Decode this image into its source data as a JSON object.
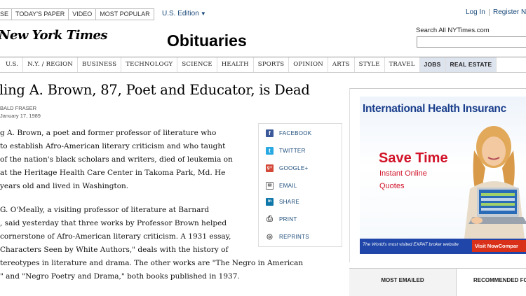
{
  "topbar": {
    "nav": [
      "SE",
      "TODAY'S PAPER",
      "VIDEO",
      "MOST POPULAR"
    ],
    "edition": "U.S. Edition",
    "login": "Log In",
    "register": "Register N"
  },
  "header": {
    "logo": "New York Times",
    "section": "Obituaries",
    "search_label": "Search All NYTimes.com"
  },
  "section_nav": [
    "U.S.",
    "N.Y. / REGION",
    "BUSINESS",
    "TECHNOLOGY",
    "SCIENCE",
    "HEALTH",
    "SPORTS",
    "OPINION",
    "ARTS",
    "STYLE",
    "TRAVEL",
    "JOBS",
    "REAL ESTATE"
  ],
  "article": {
    "headline": "ling A. Brown, 87, Poet and Educator, is Dead",
    "byline": "BALD FRASER",
    "date": "January 17, 1989",
    "paragraphs": [
      [
        "g A. Brown, a poet and former professor of literature who",
        "to establish Afro-American literary criticism and who taught",
        "of the nation's black scholars and writers, died of leukemia on",
        "at the Heritage Health Care Center in Takoma Park, Md. He",
        "years old and lived in Washington."
      ],
      [
        "G. O'Meally, a visiting professor of literature at Barnard",
        ", said yesterday that three works by Professor Brown helped",
        "cornerstone of Afro-American literary criticism. A 1931 essay,",
        "Characters Seen by White Authors,\" deals with the history of",
        "tereotypes in literature and drama. The other works are \"The Negro in American",
        "\" and \"Negro Poetry and Drama,\" both books published in 1937."
      ]
    ]
  },
  "share_tools": [
    {
      "label": "FACEBOOK",
      "icon": "facebook-icon",
      "glyph": "f",
      "color": "#3b5998"
    },
    {
      "label": "TWITTER",
      "icon": "twitter-icon",
      "glyph": "t",
      "color": "#29a9e1"
    },
    {
      "label": "GOOGLE+",
      "icon": "google-plus-icon",
      "glyph": "g+",
      "color": "#d34836"
    },
    {
      "label": "EMAIL",
      "icon": "email-icon",
      "glyph": "✉",
      "color": "#666666"
    },
    {
      "label": "SHARE",
      "icon": "linkedin-icon",
      "glyph": "in",
      "color": "#0e76a8"
    },
    {
      "label": "PRINT",
      "icon": "print-icon",
      "glyph": "⎙",
      "color": "#666666"
    },
    {
      "label": "REPRINTS",
      "icon": "reprints-icon",
      "glyph": "◎",
      "color": "#666666"
    }
  ],
  "ad": {
    "title": "International Health Insuranc",
    "headline": "Save Time",
    "sub1": "Instant Online",
    "sub2": "Quotes",
    "tagline": "The World's most visited EXPAT broker website",
    "cta": "Visit NowCompar"
  },
  "tabs": {
    "most_emailed": "MOST EMAILED",
    "recommended": "RECOMMENDED FOR"
  },
  "colors": {
    "link": "#1a4a7a",
    "ad_blue": "#1b3f8c",
    "ad_red": "#d2142a"
  }
}
